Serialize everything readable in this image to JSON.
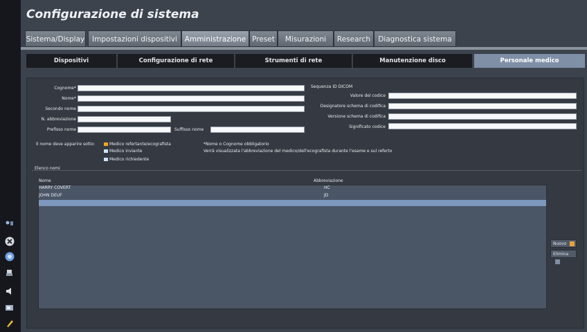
{
  "app": {
    "title": "Configurazione di sistema"
  },
  "tabs": [
    {
      "label": "Sistema/Display"
    },
    {
      "label": "Impostazioni dispositivi"
    },
    {
      "label": "Amministrazione",
      "active": true
    },
    {
      "label": "Preset"
    },
    {
      "label": "Misurazioni"
    },
    {
      "label": "Research"
    },
    {
      "label": "Diagnostica sistema"
    }
  ],
  "subtabs": [
    {
      "label": "Dispositivi"
    },
    {
      "label": "Configurazione di rete"
    },
    {
      "label": "Strumenti di rete"
    },
    {
      "label": "Manutenzione disco"
    },
    {
      "label": "Personale medico",
      "active": true
    }
  ],
  "form": {
    "cognome_label": "Cognome*",
    "cognome_value": "",
    "nome_label": "Nome*",
    "nome_value": "",
    "secondo_nome_label": "Secondo nome",
    "secondo_nome_value": "",
    "abbreviazione_label": "N. abbreviazione",
    "abbreviazione_value": "",
    "prefisso_label": "Prefisso nome",
    "prefisso_value": "",
    "suffisso_label": "Suffisso nome",
    "suffisso_value": ""
  },
  "dicom": {
    "section_label": "Sequenza ID DICOM",
    "valore_label": "Valore del codice",
    "designatore_label": "Designatore schema di codifica",
    "versione_label": "Versione schema di codifica",
    "significato_label": "Significato codice"
  },
  "appear": {
    "label": "Il nome deve apparire sotto:",
    "options": [
      {
        "label": "Medico refertante/ecografista",
        "selected": true
      },
      {
        "label": "Medico inviante",
        "selected": false
      },
      {
        "label": "Medico richiedente",
        "selected": false
      }
    ]
  },
  "notes": {
    "required": "*Nome o Cognome obbligatorio",
    "info": "Verrà visualizzata l'abbreviazione del medico/dell'ecografista durante l'esame e sul referto"
  },
  "names_list": {
    "title": "Elenco nomi",
    "col_name": "Nome",
    "col_abbr": "Abbreviazione",
    "rows": [
      {
        "name": "HARRY COVERT",
        "abbr": "HC"
      },
      {
        "name": "JOHN DEUF",
        "abbr": "JD"
      }
    ]
  },
  "buttons": {
    "new_label": "Nuovo",
    "delete_label": "Elimina"
  },
  "colors": {
    "background": "#3d434d",
    "active_subtab": "#7e8fa6",
    "selected_option": "#f3a423",
    "list_bg": "#4a5566",
    "list_selected_row": "#7d97bd"
  }
}
